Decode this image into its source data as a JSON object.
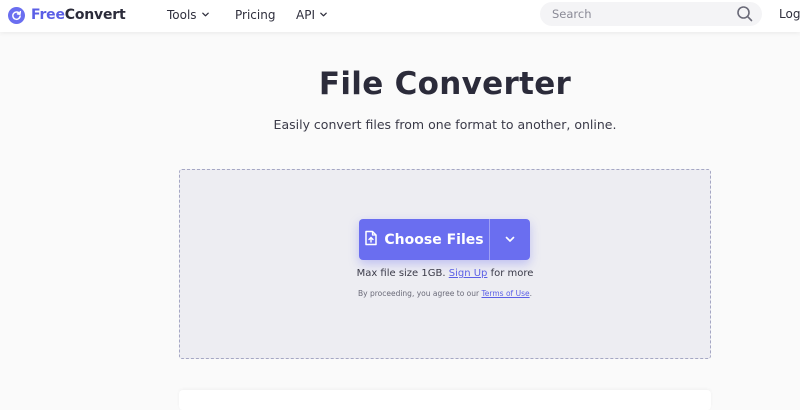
{
  "header": {
    "logo": {
      "free": "Free",
      "convert": "Convert"
    },
    "nav": [
      {
        "label": "Tools",
        "dropdown": true
      },
      {
        "label": "Pricing",
        "dropdown": false
      },
      {
        "label": "API",
        "dropdown": true
      }
    ],
    "search": {
      "placeholder": "Search"
    },
    "login_label": "Log"
  },
  "hero": {
    "title": "File Converter",
    "subtitle": "Easily convert files from one format to another, online."
  },
  "dropzone": {
    "choose_label": "Choose Files",
    "max_prefix": "Max file size 1GB.",
    "signup_label": "Sign Up",
    "max_suffix": "for more",
    "terms_prefix": "By proceeding, you agree to our",
    "terms_link": "Terms of Use",
    "terms_suffix": "."
  },
  "colors": {
    "brand": "#6a6ef0",
    "link": "#5b5fe6",
    "text": "#2b2b3a",
    "dropzone_bg": "#ededf2"
  },
  "icons": [
    "logo-refresh-icon",
    "chevron-down-icon",
    "search-icon",
    "file-upload-icon"
  ]
}
